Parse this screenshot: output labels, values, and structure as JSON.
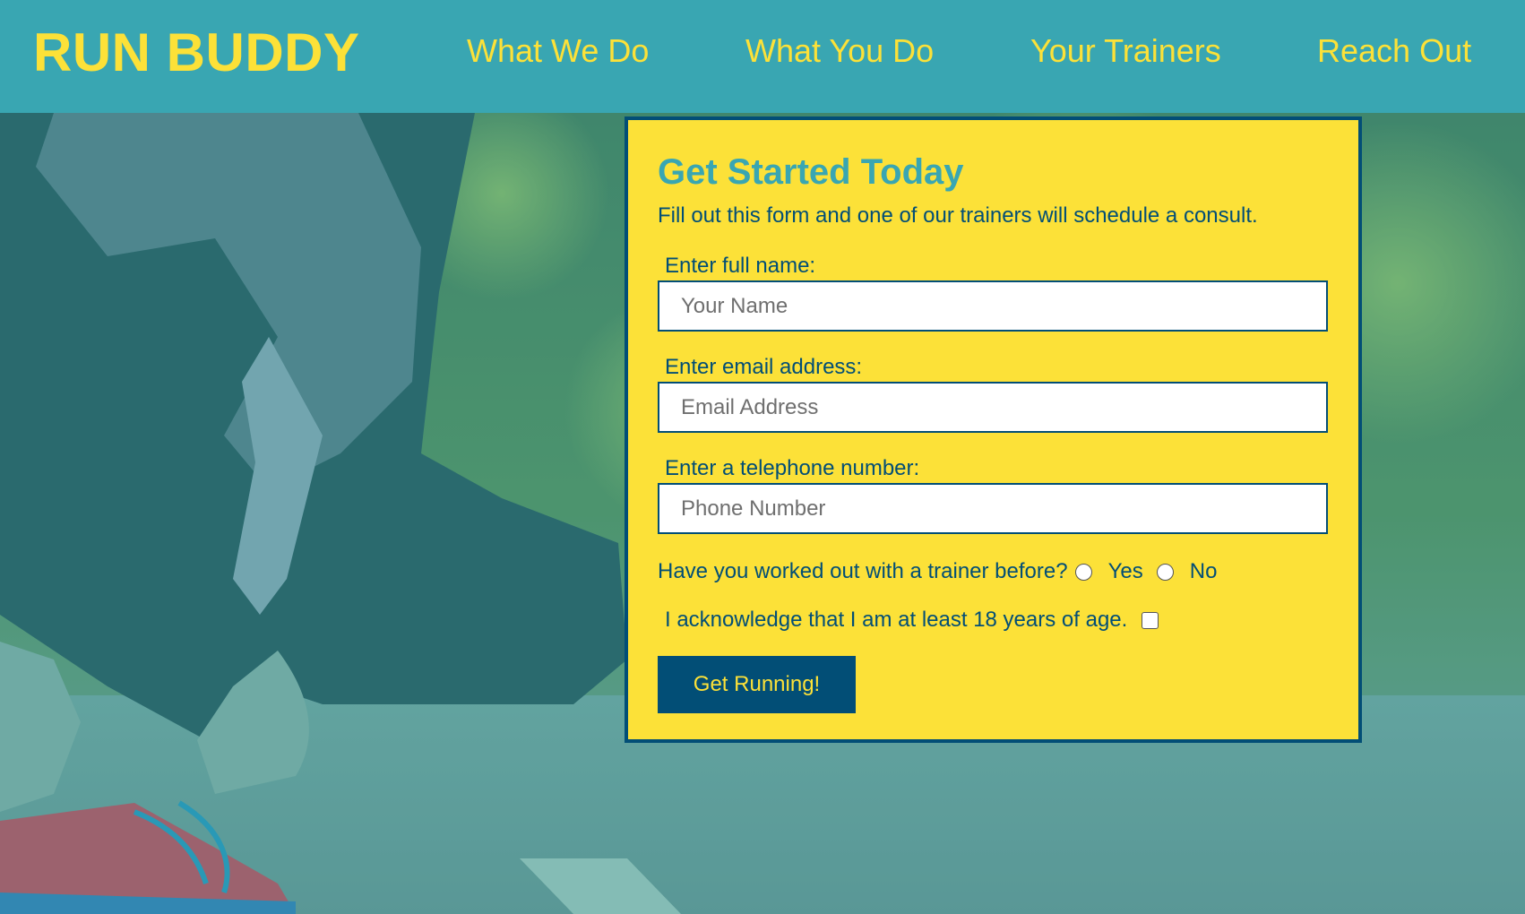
{
  "header": {
    "brand": "RUN BUDDY",
    "nav": [
      {
        "label": "What We Do"
      },
      {
        "label": "What You Do"
      },
      {
        "label": "Your Trainers"
      },
      {
        "label": "Reach Out"
      }
    ]
  },
  "form": {
    "title": "Get Started Today",
    "subtitle": "Fill out this form and one of our trainers will schedule a consult.",
    "name_label": "Enter full name:",
    "name_placeholder": "Your Name",
    "email_label": "Enter email address:",
    "email_placeholder": "Email Address",
    "phone_label": "Enter a telephone number:",
    "phone_placeholder": "Phone Number",
    "trainer_question": "Have you worked out with a trainer before?",
    "option_yes": "Yes",
    "option_no": "No",
    "age_ack": "I acknowledge that I am at least 18 years of age.",
    "submit": "Get Running!"
  },
  "colors": {
    "header_bg": "#39a6b2",
    "brand_yellow": "#fce138",
    "navy": "#024e76"
  }
}
